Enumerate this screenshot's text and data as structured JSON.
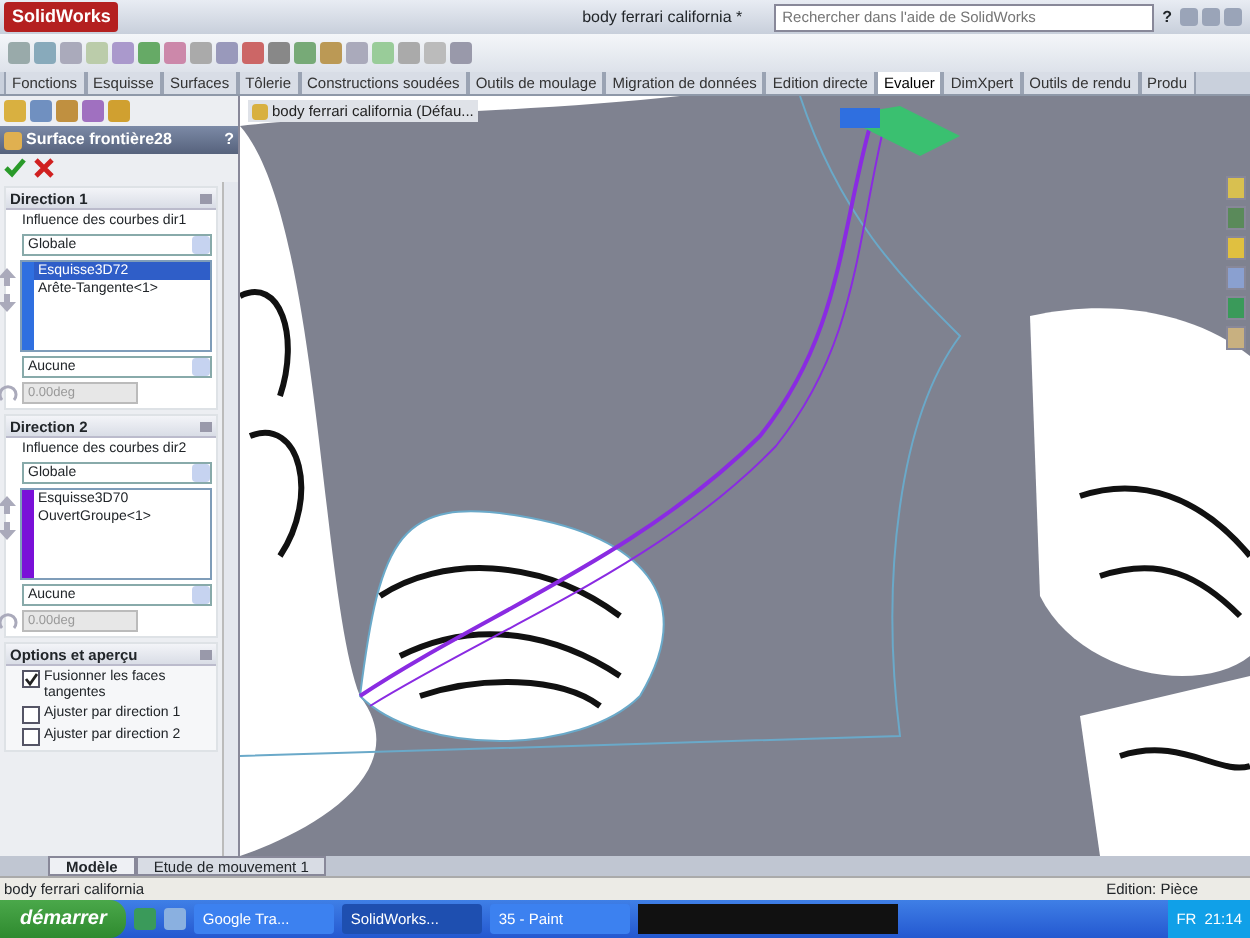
{
  "window": {
    "app_name": "SolidWorks",
    "title": "body ferrari california *",
    "search": {
      "placeholder": "Rechercher dans l'aide de SolidWorks"
    },
    "help": "?"
  },
  "tabs": [
    {
      "label": "Fonctions",
      "selected": false
    },
    {
      "label": "Esquisse",
      "selected": false
    },
    {
      "label": "Surfaces",
      "selected": false
    },
    {
      "label": "Tôlerie",
      "selected": false
    },
    {
      "label": "Constructions soudées",
      "selected": false
    },
    {
      "label": "Outils de moulage",
      "selected": false
    },
    {
      "label": "Migration de données",
      "selected": false
    },
    {
      "label": "Edition directe",
      "selected": false
    },
    {
      "label": "Evaluer",
      "selected": true
    },
    {
      "label": "DimXpert",
      "selected": false
    },
    {
      "label": "Outils de rendu",
      "selected": false
    },
    {
      "label": "Produ",
      "selected": false
    }
  ],
  "property_manager": {
    "title": "Surface frontière28",
    "help": "?",
    "groups": [
      {
        "title": "Direction 1",
        "influence_label": "Influence des courbes dir1",
        "influence": "Globale",
        "color": "#2f6fe0",
        "curves": [
          {
            "label": "Esquisse3D72",
            "selected": true
          },
          {
            "label": "Arête-Tangente<1>",
            "selected": false
          }
        ],
        "tangency": "Aucune",
        "angle": "0.00deg"
      },
      {
        "title": "Direction 2",
        "influence_label": "Influence des courbes dir2",
        "influence": "Globale",
        "color": "#7a10d8",
        "curves": [
          {
            "label": "Esquisse3D70",
            "selected": false
          },
          {
            "label": "OuvertGroupe<1>",
            "selected": false
          }
        ],
        "tangency": "Aucune",
        "angle": "0.00deg"
      }
    ],
    "options": {
      "title": "Options et aperçu",
      "checkboxes": [
        {
          "label": "Fusionner les faces tangentes",
          "checked": true
        },
        {
          "label": "Ajuster par direction 1",
          "checked": false
        },
        {
          "label": "Ajuster par direction 2",
          "checked": false
        }
      ]
    }
  },
  "viewport": {
    "tree_label": "body ferrari california  (Défau..."
  },
  "bottom_tabs": [
    {
      "label": "Modèle",
      "selected": true
    },
    {
      "label": "Etude de mouvement 1",
      "selected": false
    }
  ],
  "status_bar": {
    "document": "body ferrari california",
    "mode": "Edition: Pièce"
  },
  "taskbar": {
    "start": "démarrer",
    "buttons": [
      {
        "label": "Google Tra...",
        "selected": false
      },
      {
        "label": "SolidWorks...",
        "selected": true
      },
      {
        "label": "35 - Paint",
        "selected": false
      }
    ],
    "language": "FR",
    "clock": "21:14"
  }
}
